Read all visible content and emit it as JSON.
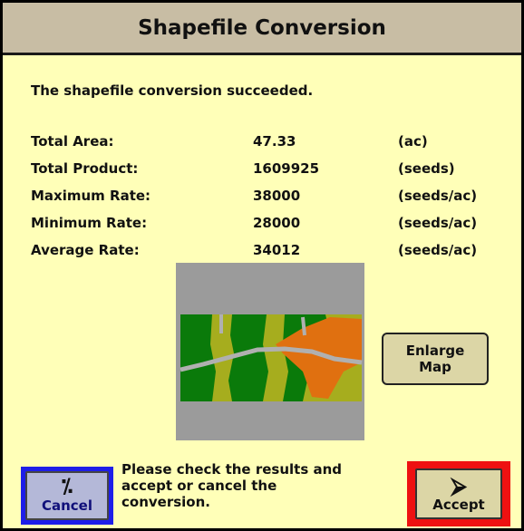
{
  "dialog": {
    "title": "Shapefile Conversion",
    "message": "The shapefile conversion succeeded.",
    "stats": [
      {
        "label": "Total Area:",
        "value": "47.33",
        "unit": "(ac)"
      },
      {
        "label": "Total Product:",
        "value": "1609925",
        "unit": "(seeds)"
      },
      {
        "label": "Maximum Rate:",
        "value": "38000",
        "unit": "(seeds/ac)"
      },
      {
        "label": "Minimum Rate:",
        "value": "28000",
        "unit": "(seeds/ac)"
      },
      {
        "label": "Average Rate:",
        "value": "34012",
        "unit": "(seeds/ac)"
      }
    ],
    "enlarge_button": {
      "line1": "Enlarge",
      "line2": "Map"
    },
    "footer_message": [
      "Please check the results and",
      "accept or cancel the",
      "conversion."
    ],
    "cancel_button": {
      "label": "Cancel",
      "icon": "percent-cancel-icon"
    },
    "accept_button": {
      "label": "Accept",
      "icon": "arrow-right-diamond-icon"
    }
  },
  "colors": {
    "background": "#ffffb8",
    "title_bar": "#c8bda4",
    "cancel_highlight": "#1e1ee8",
    "accept_highlight": "#ee1111",
    "map_dark_green": "#0a7a0a",
    "map_yellow_green": "#a6ad1e",
    "map_orange": "#e07010"
  }
}
